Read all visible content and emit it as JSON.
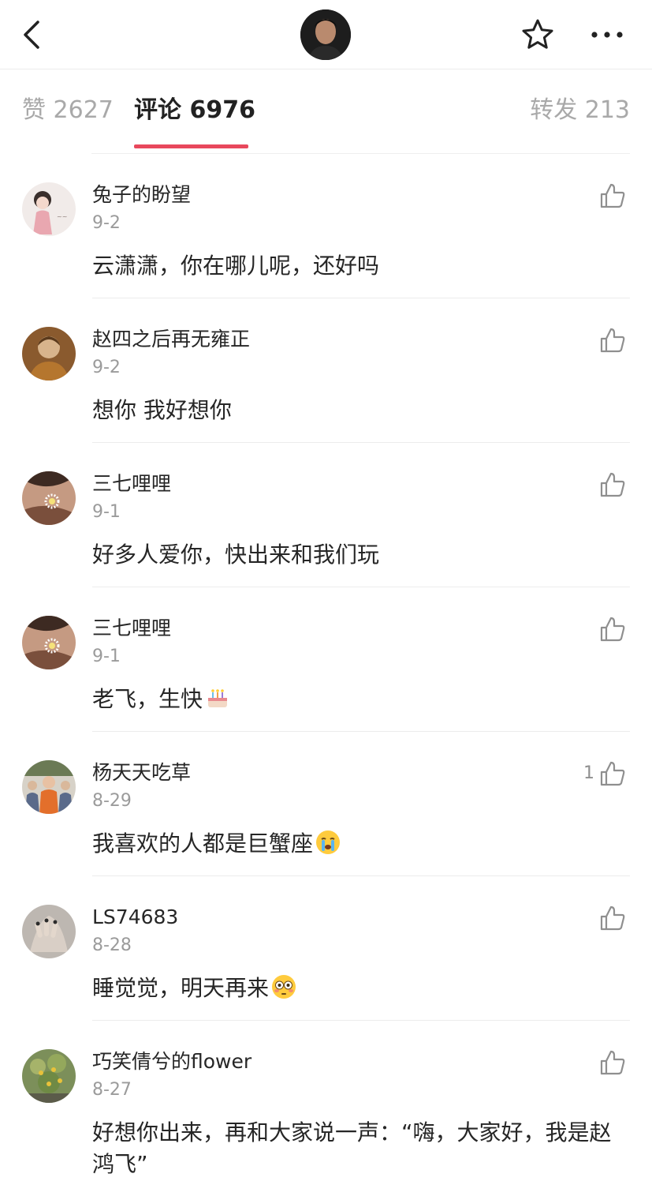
{
  "header": {
    "back_icon": "chevron-left-icon",
    "favorite_icon": "star-outline-icon",
    "more_icon": "more-horizontal-icon"
  },
  "tabs": {
    "likes": "赞 2627",
    "comments": "评论 6976",
    "reposts": "转发 213",
    "active": "comments",
    "accent_color": "#e8485c"
  },
  "comments": [
    {
      "username": "兔子的盼望",
      "date": "9-2",
      "text": "云潇潇，你在哪儿呢，还好吗",
      "likes": ""
    },
    {
      "username": "赵四之后再无雍正",
      "date": "9-2",
      "text": "想你 我好想你",
      "likes": ""
    },
    {
      "username": "三七哩哩",
      "date": "9-1",
      "text": "好多人爱你，快出来和我们玩",
      "likes": ""
    },
    {
      "username": "三七哩哩",
      "date": "9-1",
      "text": "老飞，生快",
      "likes": "",
      "emoji": "birthday-cake-emoji"
    },
    {
      "username": "杨天天吃草",
      "date": "8-29",
      "text": "我喜欢的人都是巨蟹座",
      "likes": "1",
      "emoji": "crying-face-emoji"
    },
    {
      "username": "LS74683",
      "date": "8-28",
      "text": "睡觉觉，明天再来",
      "likes": "",
      "emoji": "flushed-face-emoji"
    },
    {
      "username": "巧笑倩兮的flower",
      "date": "8-27",
      "text": "好想你出来，再和大家说一声：“嗨，大家好，我是赵鸿飞”",
      "likes": ""
    }
  ]
}
